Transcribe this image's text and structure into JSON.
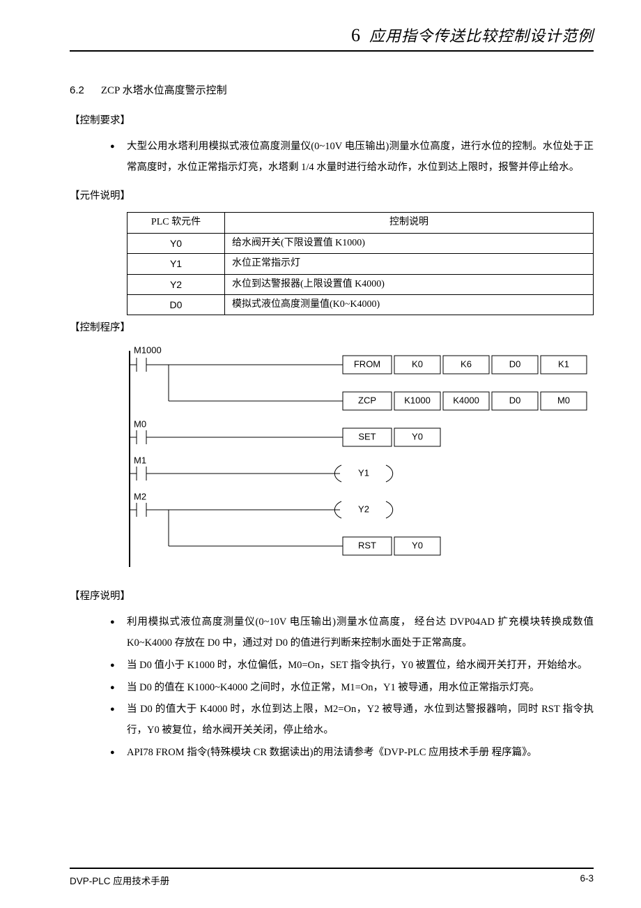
{
  "chapter": {
    "num": "6",
    "title": "应用指令传送比较控制设计范例"
  },
  "section": {
    "num": "6.2",
    "title": "ZCP 水塔水位高度警示控制"
  },
  "subheads": {
    "req": "【控制要求】",
    "comp": "【元件说明】",
    "prog": "【控制程序】",
    "desc": "【程序说明】"
  },
  "req_bullets": [
    "大型公用水塔利用模拟式液位高度测量仪(0~10V 电压输出)测量水位高度，进行水位的控制。水位处于正常高度时，水位正常指示灯亮，水塔剩 1/4 水量时进行给水动作，水位到达上限时，报警并停止给水。"
  ],
  "comp_table": {
    "headers": [
      "PLC 软元件",
      "控制说明"
    ],
    "rows": [
      [
        "Y0",
        "给水阀开关(下限设置值 K1000)"
      ],
      [
        "Y1",
        "水位正常指示灯"
      ],
      [
        "Y2",
        "水位到达警报器(上限设置值 K4000)"
      ],
      [
        "D0",
        "模拟式液位高度测量值(K0~K4000)"
      ]
    ]
  },
  "ladder": {
    "rungs": [
      {
        "contact": "M1000",
        "boxes": [
          "FROM",
          "K0",
          "K6",
          "D0",
          "K1"
        ]
      },
      {
        "contact": "",
        "boxes": [
          "ZCP",
          "K1000",
          "K4000",
          "D0",
          "M0"
        ]
      },
      {
        "contact": "M0",
        "boxes": [
          "SET",
          "Y0"
        ]
      },
      {
        "contact": "M1",
        "coil": "Y1"
      },
      {
        "contact": "M2",
        "coil": "Y2"
      },
      {
        "contact": "",
        "boxes": [
          "RST",
          "Y0"
        ]
      }
    ]
  },
  "desc_bullets": [
    "利用模拟式液位高度测量仪(0~10V 电压输出)测量水位高度，  经台达 DVP04AD 扩充模块转换成数值 K0~K4000 存放在 D0 中，通过对 D0 的值进行判断来控制水面处于正常高度。",
    "当 D0 值小于 K1000 时，水位偏低，M0=On，SET 指令执行，Y0 被置位，给水阀开关打开，开始给水。",
    "当 D0 的值在 K1000~K4000 之间时，水位正常，M1=On，Y1 被导通，用水位正常指示灯亮。",
    "当 D0 的值大于 K4000 时，水位到达上限，M2=On，Y2 被导通，水位到达警报器响，同时 RST 指令执行，Y0 被复位，给水阀开关关闭，停止给水。",
    "API78 FROM 指令(特殊模块 CR 数据读出)的用法请参考《DVP-PLC 应用技术手册  程序篇》。"
  ],
  "footer": {
    "left": "DVP-PLC  应用技术手册",
    "right": "6-3"
  }
}
